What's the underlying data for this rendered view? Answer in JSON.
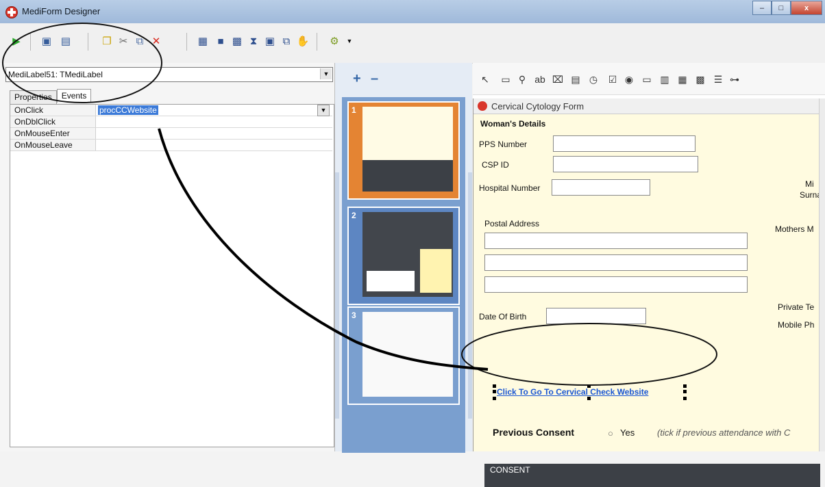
{
  "window": {
    "title": "MediForm Designer",
    "buttons": {
      "min": "–",
      "max": "□",
      "close": "x"
    }
  },
  "toolbar": {
    "icons": [
      "play-icon",
      "save-icon",
      "save-all-icon",
      "new-page-icon",
      "cut-icon",
      "copy-icon",
      "delete-icon",
      "align-icon",
      "grid-icon",
      "layout-icon",
      "order-icon",
      "hand-icon",
      "tools-icon"
    ]
  },
  "inspector": {
    "selected_component": "MediLabel51: TMediLabel",
    "tabs": [
      "Properties",
      "Events"
    ],
    "events": [
      {
        "name": "OnClick",
        "value": "procCCWebsite"
      },
      {
        "name": "OnDblClick",
        "value": ""
      },
      {
        "name": "OnMouseEnter",
        "value": ""
      },
      {
        "name": "OnMouseLeave",
        "value": ""
      }
    ]
  },
  "pages": {
    "add_label": "+",
    "remove_label": "–",
    "thumbnails": [
      {
        "number": "1"
      },
      {
        "number": "2"
      },
      {
        "number": "3"
      }
    ]
  },
  "form": {
    "caption": "Cervical Cytology Form",
    "section_title": "Woman's Details",
    "fields": {
      "pps": "PPS Number",
      "csp": "CSP ID",
      "hospital": "Hospital Number",
      "postal": "Postal Address",
      "dob": "Date Of Birth"
    },
    "right_labels": {
      "mi": "Mi",
      "surname": "Surna",
      "mothers": "Mothers M",
      "private": "Private Te",
      "mobile": "Mobile Ph"
    },
    "link_text": "Click To Go To Cervical Check Website",
    "previous_consent": "Previous Consent",
    "yes": "Yes",
    "note": "(tick if previous attendance with C",
    "consent_header": "CONSENT"
  }
}
